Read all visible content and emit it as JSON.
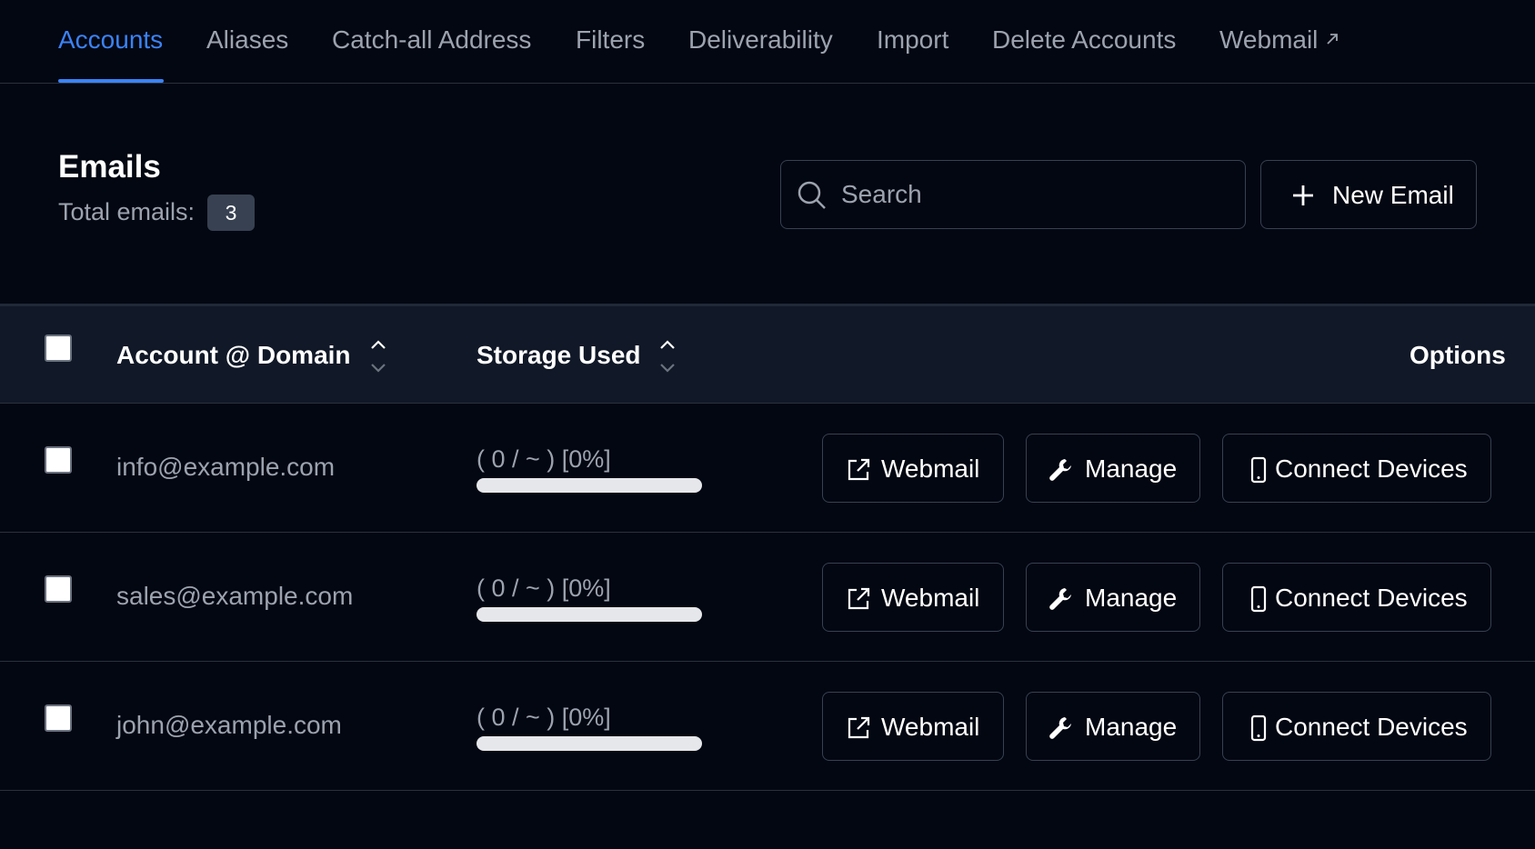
{
  "tabs": [
    {
      "label": "Accounts",
      "active": true
    },
    {
      "label": "Aliases"
    },
    {
      "label": "Catch-all Address"
    },
    {
      "label": "Filters"
    },
    {
      "label": "Deliverability"
    },
    {
      "label": "Import"
    },
    {
      "label": "Delete Accounts"
    },
    {
      "label": "Webmail",
      "icon": "external-arrow-icon"
    }
  ],
  "header": {
    "title": "Emails",
    "total_label": "Total emails:",
    "total_count": "3"
  },
  "search": {
    "placeholder": "Search",
    "value": ""
  },
  "new_email_button": {
    "label": "New Email",
    "icon": "plus-icon"
  },
  "table": {
    "columns": {
      "account": "Account @ Domain",
      "storage": "Storage Used",
      "options": "Options"
    },
    "rows": [
      {
        "email": "info@example.com",
        "storage": "( 0 / ~ ) [0%]",
        "usage_fraction": 0
      },
      {
        "email": "sales@example.com",
        "storage": "( 0 / ~ ) [0%]",
        "usage_fraction": 0
      },
      {
        "email": "john@example.com",
        "storage": "( 0 / ~ ) [0%]",
        "usage_fraction": 0
      }
    ],
    "actions": {
      "webmail": "Webmail",
      "manage": "Manage",
      "connect": "Connect Devices"
    }
  },
  "colors": {
    "background": "#030712",
    "accent": "#3b82f6",
    "header_bg": "#111827",
    "muted_text": "#9ca3af",
    "border": "#374151"
  }
}
